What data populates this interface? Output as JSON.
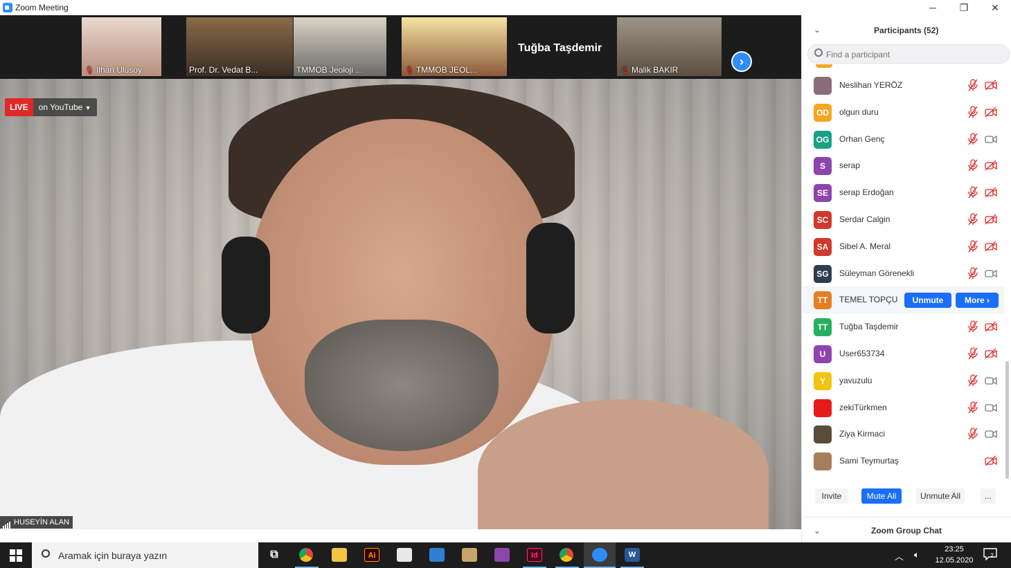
{
  "window": {
    "title": "Zoom Meeting",
    "minimize": "─",
    "maximize": "❐",
    "close": "✕"
  },
  "strip": {
    "thumbs": [
      {
        "name": "İlhan Ulusoy",
        "muted": true
      },
      {
        "name": "Prof. Dr. Vedat B...",
        "muted": false
      },
      {
        "name": "TMMOB Jeoloji ...",
        "muted": false
      },
      {
        "name": "TMMOB JEOL...",
        "muted": true
      },
      {
        "name": "Tuğba Taşdemir",
        "muted": true
      },
      {
        "name": "Malik BAKIR",
        "muted": true
      }
    ],
    "next_icon": "chevron-right-icon"
  },
  "live": {
    "badge": "LIVE",
    "platform": "on YouTube"
  },
  "speaker": {
    "name": "HUSEYİN ALAN"
  },
  "panel": {
    "title": "Participants (52)",
    "search_placeholder": "Find a participant",
    "participants": [
      {
        "name": "Neslihan YERÖZ",
        "initials": "",
        "color": "#8a6d7a",
        "cam_off": true,
        "mic_muted": true
      },
      {
        "name": "olgun duru",
        "initials": "OD",
        "color": "#f5a623",
        "cam_off": true,
        "mic_muted": true
      },
      {
        "name": "Orhan Genç",
        "initials": "OG",
        "color": "#18a085",
        "cam_off": false,
        "mic_muted": true
      },
      {
        "name": "serap",
        "initials": "S",
        "color": "#8e44ad",
        "cam_off": true,
        "mic_muted": true
      },
      {
        "name": "serap Erdoğan",
        "initials": "SE",
        "color": "#8e44ad",
        "cam_off": true,
        "mic_muted": true
      },
      {
        "name": "Serdar Calgin",
        "initials": "SC",
        "color": "#d0392b",
        "cam_off": true,
        "mic_muted": true
      },
      {
        "name": "Sibel A. Meral",
        "initials": "SA",
        "color": "#d0392b",
        "cam_off": true,
        "mic_muted": true
      },
      {
        "name": "Süleyman Görenekli",
        "initials": "SG",
        "color": "#2c3e50",
        "cam_off": false,
        "mic_muted": true
      },
      {
        "name": "TEMEL TOPÇU",
        "initials": "TT",
        "color": "#e67e22",
        "cam_off": false,
        "mic_muted": true
      },
      {
        "name": "Tuğba Taşdemir",
        "initials": "TT",
        "color": "#27ae60",
        "cam_off": true,
        "mic_muted": true
      },
      {
        "name": "User653734",
        "initials": "U",
        "color": "#8e44ad",
        "cam_off": true,
        "mic_muted": true
      },
      {
        "name": "yavuzulu",
        "initials": "Y",
        "color": "#f1c40f",
        "cam_off": false,
        "mic_muted": true
      },
      {
        "name": "zekiTürkmen",
        "initials": "",
        "color": "#e81b1b",
        "cam_off": false,
        "mic_muted": true
      },
      {
        "name": "Ziya Kirmaci",
        "initials": "",
        "color": "#5b4b3a",
        "cam_off": false,
        "mic_muted": true
      },
      {
        "name": "Sami Teymurtaş",
        "initials": "",
        "color": "#a57f5a",
        "cam_off": true,
        "mic_muted": false
      }
    ],
    "row_buttons": {
      "unmute": "Unmute",
      "more": "More ›"
    },
    "footer": {
      "invite": "Invite",
      "mute_all": "Mute All",
      "unmute_all": "Unmute All",
      "more": "..."
    },
    "chat_title": "Zoom Group Chat"
  },
  "taskbar": {
    "search_placeholder": "Aramak için buraya yazın",
    "time": "23:25",
    "date": "12.05.2020",
    "notifications": "2",
    "apps": [
      {
        "name": "task-view-icon",
        "label": "⧉",
        "color": "#ffffff"
      },
      {
        "name": "chrome-icon",
        "label": "",
        "color": "#dd4b39"
      },
      {
        "name": "file-explorer-icon",
        "label": "",
        "color": "#f4c542"
      },
      {
        "name": "illustrator-icon",
        "label": "Ai",
        "color": "#ff9a00"
      },
      {
        "name": "store-icon",
        "label": "",
        "color": "#ffffff"
      },
      {
        "name": "mail-icon",
        "label": "",
        "color": "#2d7fd2"
      },
      {
        "name": "paint-icon",
        "label": "",
        "color": "#c9a46b"
      },
      {
        "name": "winrar-icon",
        "label": "",
        "color": "#8e44ad"
      },
      {
        "name": "indesign-icon",
        "label": "Id",
        "color": "#ff3366"
      },
      {
        "name": "chrome-icon-2",
        "label": "",
        "color": "#dd4b39"
      },
      {
        "name": "zoom-icon",
        "label": "",
        "color": "#2d8cff"
      },
      {
        "name": "word-icon",
        "label": "W",
        "color": "#2b579a"
      }
    ]
  },
  "colors": {
    "accent": "#1a6ef7",
    "live": "#e02828",
    "muted": "#e02828"
  }
}
